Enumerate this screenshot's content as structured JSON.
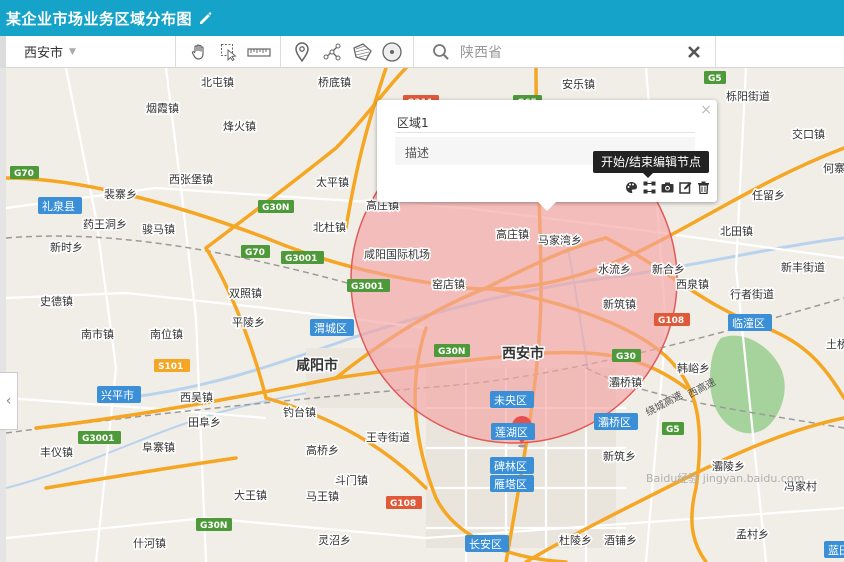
{
  "title": "某企业市场业务区域分布图",
  "toolbar": {
    "city": "西安市",
    "search_value": "陕西省",
    "icons": [
      "pan-icon",
      "select-icon",
      "ruler-icon",
      "marker-icon",
      "polyline-icon",
      "polygon-icon",
      "circle-icon",
      "search-icon",
      "clear-icon"
    ]
  },
  "popup": {
    "name": "区域1",
    "description": "描述",
    "tools": [
      "palette-icon",
      "edit-nodes-icon",
      "camera-icon",
      "edit-icon",
      "trash-icon"
    ],
    "tooltip": "开始/结束编辑节点"
  },
  "colors": {
    "title_bg": "#16a3c9",
    "area_fill": "#f4a3a3",
    "area_stroke": "#e05a5a",
    "highway": "#f5a623",
    "highway_badge": "#4e9a3a",
    "district_badge": "#3a8fd6",
    "marker": "#e84e4e",
    "green_park": "#9ccc94"
  },
  "map": {
    "labels": [
      "北屯镇",
      "桥底镇",
      "安乐镇",
      "栎阳街道",
      "烟霞镇",
      "烽火镇",
      "交口镇",
      "礼泉县",
      "裴寨乡",
      "西张堡镇",
      "太平镇",
      "北杜镇",
      "高庄镇",
      "马家湾乡",
      "北田镇",
      "药王洞乡",
      "骏马镇",
      "新时乡",
      "咸阳国际机场",
      "高庄镇",
      "水流乡",
      "新合乡",
      "新丰街道",
      "史德镇",
      "双照镇",
      "窑店镇",
      "新筑镇",
      "西泉镇",
      "行者街道",
      "南市镇",
      "南位镇",
      "平陵乡",
      "渭城区",
      "临潼区",
      "咸阳市",
      "西安市",
      "灞桥镇",
      "韩峪乡",
      "兴平市",
      "西吴镇",
      "钓台镇",
      "未央区",
      "田阜乡",
      "王寺街道",
      "灞桥区",
      "丰仪镇",
      "阜寨镇",
      "高桥乡",
      "莲湖区",
      "新筑乡",
      "碑林区",
      "灞陵乡",
      "大王镇",
      "斗门镇",
      "雁塔区",
      "马王镇",
      "冯家村",
      "灵沼乡",
      "杜陵乡",
      "酒铺乡",
      "孟村乡",
      "长安区",
      "蓝田",
      "土桥",
      "任留乡",
      "何寨",
      "什河镇"
    ],
    "roads": [
      "G70",
      "G30N",
      "G211",
      "G65",
      "G5",
      "G70",
      "G3001",
      "G3001",
      "G30N",
      "G30",
      "S101",
      "G3001",
      "G5",
      "G108",
      "G108",
      "G30N"
    ],
    "road_names": [
      "西高速",
      "绕城高速"
    ],
    "watermark": "Baidu经验 jingyan.baidu.com"
  }
}
